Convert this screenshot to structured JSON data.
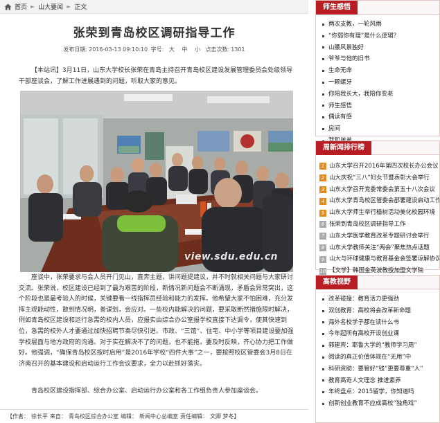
{
  "breadcrumb": {
    "home": "首页",
    "section": "山大要闻",
    "current": "正文"
  },
  "article": {
    "title": "张荣到青岛校区调研指导工作",
    "meta": {
      "date_label": "发布日期:",
      "date": "2016-03-13 09:10:10",
      "font_label": "字号:",
      "font_large": "大",
      "font_medium": "中",
      "font_small": "小",
      "hits_label": "点击次数:",
      "hits": "1301"
    },
    "lead": "【本站讯】3月11日，山东大学校长张荣在青岛主持召开青岛校区建设发展管理委员会处级领导干部座谈会，了解工作进展遇到的问题，听取大家的意见。",
    "photo_watermark": "view.sdu.edu.cn",
    "body1": "座谈中，张荣要求与会人员开门见山，直奔主题，讲问题提建议，并不时就相关问题与大家研讨交流。张荣说，校区建设已经到了最为艰苦的阶段，新情况新问题会不断涌现，矛盾会异常突出，这个阶段也是最考验人的时候，关键要看一线指挥员经验和能力的发挥。他希望大家不怕困难，充分发挥主观能动性，敢到情况明，善谋划，会应对。一些校内能解决的问题，要采取断然措施限时解决，例如青岛校区建设和运行急需的校内人员，应报实由综合办公室报学校直接下达调令，使其快速到位，急需的校外人才要通过加快招聘节奏尽快引进。市政、“三馆”、住宅、中小学等项目建设要加强学校层面与地方政府的沟通。对于实在解决不了的问题，也不能拖，要及时反映，齐心协力把工作做好。他强调，“确保青岛校区按时启用”是2016年学校“四件大事”之一，要按照校区管委会3月8日在济南召开的基本建设和启动运行工作会议要求，全力以赴抓好落实。",
    "body2": "青岛校区建设指挥部、综合办公室、启动运行办公室和各工作组负责人参加座谈会。",
    "footer": {
      "author_label": "【作者：",
      "author": "徐长平",
      "source_label": "来自：",
      "source": "青岛校区综合办公室",
      "editor_label": "编辑：",
      "editor": "新闻中心总编室",
      "duty_label": "责任编辑：",
      "duty": "文卿  梦冬】"
    }
  },
  "sidebar": {
    "box1": {
      "title": "师生感悟",
      "items": [
        "两次支教，一轮风雨",
        "“你弱你有理”是什么逻辑？",
        "山腰风景独好",
        "爷爷与他的旧书",
        "生命无命",
        "一颗螺牙",
        "你陪我长大，我陪你变老",
        "师生感悟",
        "偶读有感",
        "房间",
        "我和弟弟"
      ]
    },
    "box2": {
      "title": "周新闻排行榜",
      "items": [
        {
          "num": "1",
          "text": "山东大学召开2016年第四次校长办公会议"
        },
        {
          "num": "2",
          "text": "山大庆祝“三八”妇女节暨表彰大会举行"
        },
        {
          "num": "3",
          "text": "山东大学召开党委常委会第五十八次会议"
        },
        {
          "num": "4",
          "text": "山东大学青岛校区管委会部署建设启动工作"
        },
        {
          "num": "5",
          "text": "山东大学师生举行植树活动美化校园环境"
        },
        {
          "num": "6",
          "text": "张荣到青岛校区调研指导工作"
        },
        {
          "num": "7",
          "text": "山东大学医学教育改革专题研讨会举行"
        },
        {
          "num": "8",
          "text": "山东大学教师关注“两会”聚焦热点话题"
        },
        {
          "num": "9",
          "text": "山大与环球健康与教育基金会签署谅解协议"
        },
        {
          "num": "10",
          "text": "【文学】韩国金英波教授加盟文学院"
        }
      ]
    },
    "box3": {
      "title": "高教视野",
      "items": [
        "改革碰撞：教育活力更强劲",
        "双创教育：高校将会改革新命题",
        "海外名校学子都在读什么书",
        "今年起所有高校开设创业课",
        "郭建宾：耶鲁大学的“教师学习周”",
        "阅读的真正价值体现在“无用”中",
        "科研资助：要管好“钱”更要尊重“人”",
        "教育高奇人文理念 推进素养",
        "年终盘点：2015留学，你知道吗",
        "创新创业教育不应成高校“独角戏”"
      ]
    }
  },
  "colors": {
    "accent_red": "#b71d22",
    "rank_orange": "#e58a1f",
    "rank_grey": "#a9a9a9"
  }
}
